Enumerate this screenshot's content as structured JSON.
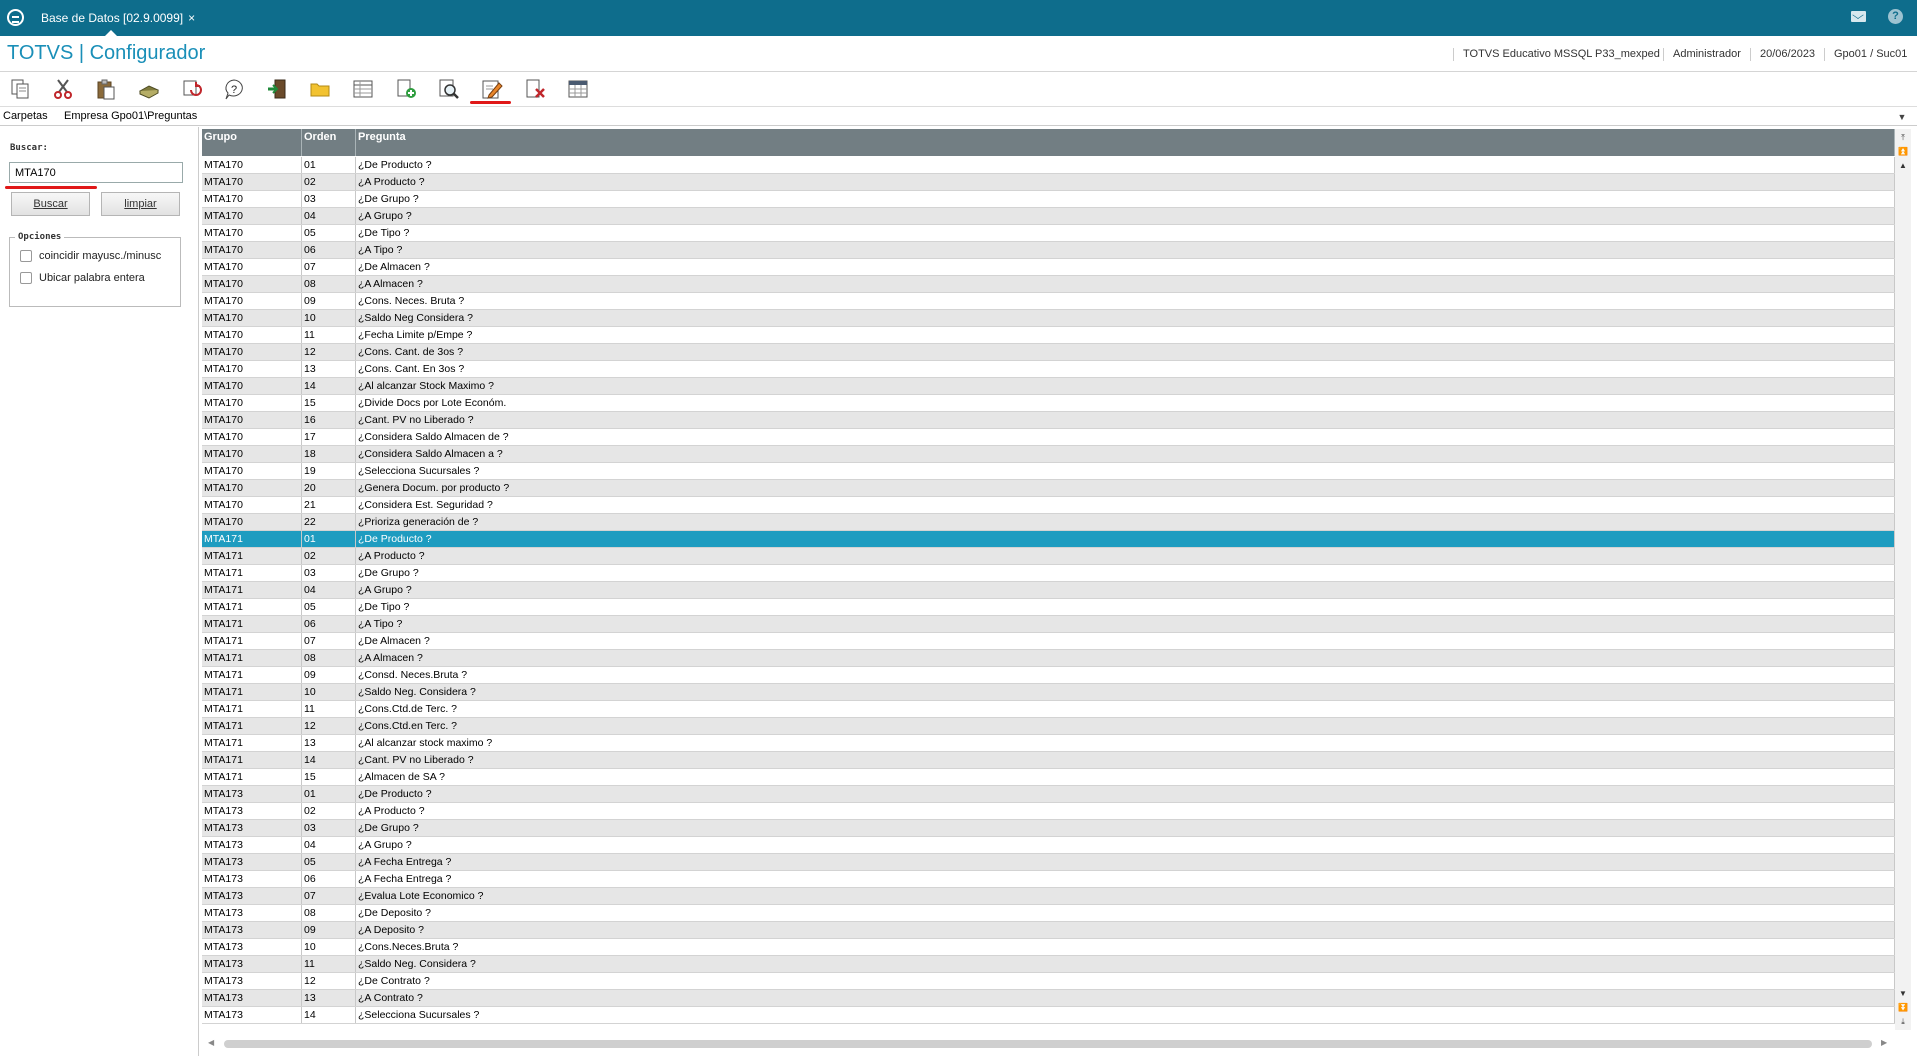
{
  "window_tab": {
    "label": "Base de Datos [02.9.0099]",
    "close": "×"
  },
  "header": {
    "title": "TOTVS | Configurador",
    "environment": "TOTVS Educativo MSSQL P33_mexped",
    "user": "Administrador",
    "date": "20/06/2023",
    "branch": "Gpo01 / Suc01"
  },
  "toolbar": {
    "icons": [
      "copy-icon",
      "cut-icon",
      "paste-icon",
      "book-icon",
      "refresh-icon",
      "help-icon",
      "exit-icon",
      "folder-icon",
      "table-icon",
      "add-document-icon",
      "search-preview-icon",
      "edit-icon",
      "delete-icon",
      "calendar-icon"
    ],
    "highlight_color": "#e01818"
  },
  "path": {
    "label": "Carpetas",
    "value": "Empresa Gpo01\\Preguntas"
  },
  "search": {
    "label": "Buscar:",
    "value": "MTA170",
    "buscar_button": "Buscar",
    "limpiar_button": "limpiar",
    "options_label": "Opciones",
    "opt_case": "coincidir mayusc./minusc",
    "opt_word": "Ubicar palabra entera"
  },
  "grid": {
    "headers": [
      "Grupo",
      "Orden",
      "Pregunta"
    ],
    "selected_index": 22,
    "rows": [
      [
        "MTA170",
        "01",
        "¿De Producto ?"
      ],
      [
        "MTA170",
        "02",
        "¿A Producto ?"
      ],
      [
        "MTA170",
        "03",
        "¿De Grupo ?"
      ],
      [
        "MTA170",
        "04",
        "¿A Grupo ?"
      ],
      [
        "MTA170",
        "05",
        "¿De Tipo ?"
      ],
      [
        "MTA170",
        "06",
        "¿A Tipo ?"
      ],
      [
        "MTA170",
        "07",
        "¿De Almacen ?"
      ],
      [
        "MTA170",
        "08",
        "¿A  Almacen ?"
      ],
      [
        "MTA170",
        "09",
        "¿Cons. Neces. Bruta ?"
      ],
      [
        "MTA170",
        "10",
        "¿Saldo Neg Considera ?"
      ],
      [
        "MTA170",
        "11",
        "¿Fecha Limite p/Empe ?"
      ],
      [
        "MTA170",
        "12",
        "¿Cons. Cant. de 3os ?"
      ],
      [
        "MTA170",
        "13",
        "¿Cons. Cant. En 3os ?"
      ],
      [
        "MTA170",
        "14",
        "¿Al alcanzar Stock Maximo ?"
      ],
      [
        "MTA170",
        "15",
        "¿Divide Docs por Lote Económ."
      ],
      [
        "MTA170",
        "16",
        "¿Cant. PV no Liberado ?"
      ],
      [
        "MTA170",
        "17",
        "¿Considera Saldo Almacen de ?"
      ],
      [
        "MTA170",
        "18",
        "¿Considera Saldo Almacen a ?"
      ],
      [
        "MTA170",
        "19",
        "¿Selecciona Sucursales ?"
      ],
      [
        "MTA170",
        "20",
        "¿Genera Docum. por producto ?"
      ],
      [
        "MTA170",
        "21",
        "¿Considera Est. Seguridad ?"
      ],
      [
        "MTA170",
        "22",
        "¿Prioriza generación de ?"
      ],
      [
        "MTA171",
        "01",
        "¿De Producto ?"
      ],
      [
        "MTA171",
        "02",
        "¿A Producto ?"
      ],
      [
        "MTA171",
        "03",
        "¿De Grupo ?"
      ],
      [
        "MTA171",
        "04",
        "¿A Grupo ?"
      ],
      [
        "MTA171",
        "05",
        "¿De Tipo ?"
      ],
      [
        "MTA171",
        "06",
        "¿A Tipo ?"
      ],
      [
        "MTA171",
        "07",
        "¿De Almacen ?"
      ],
      [
        "MTA171",
        "08",
        "¿A  Almacen ?"
      ],
      [
        "MTA171",
        "09",
        "¿Consd. Neces.Bruta ?"
      ],
      [
        "MTA171",
        "10",
        "¿Saldo Neg. Considera ?"
      ],
      [
        "MTA171",
        "11",
        "¿Cons.Ctd.de Terc. ?"
      ],
      [
        "MTA171",
        "12",
        "¿Cons.Ctd.en Terc. ?"
      ],
      [
        "MTA171",
        "13",
        "¿Al alcanzar stock maximo ?"
      ],
      [
        "MTA171",
        "14",
        "¿Cant. PV no Liberado ?"
      ],
      [
        "MTA171",
        "15",
        "¿Almacen de SA ?"
      ],
      [
        "MTA173",
        "01",
        "¿De Producto ?"
      ],
      [
        "MTA173",
        "02",
        "¿A Producto ?"
      ],
      [
        "MTA173",
        "03",
        "¿De Grupo ?"
      ],
      [
        "MTA173",
        "04",
        "¿A Grupo ?"
      ],
      [
        "MTA173",
        "05",
        "¿A Fecha Entrega ?"
      ],
      [
        "MTA173",
        "06",
        "¿A Fecha Entrega ?"
      ],
      [
        "MTA173",
        "07",
        "¿Evalua Lote Economico ?"
      ],
      [
        "MTA173",
        "08",
        "¿De Deposito ?"
      ],
      [
        "MTA173",
        "09",
        "¿A Deposito ?"
      ],
      [
        "MTA173",
        "10",
        "¿Cons.Neces.Bruta ?"
      ],
      [
        "MTA173",
        "11",
        "¿Saldo Neg. Considera ?"
      ],
      [
        "MTA173",
        "12",
        "¿De Contrato ?"
      ],
      [
        "MTA173",
        "13",
        "¿A Contrato ?"
      ],
      [
        "MTA173",
        "14",
        "¿Selecciona Sucursales ?"
      ]
    ]
  },
  "colors": {
    "titlebar": "#0e6d8c",
    "title_text": "#1a8fb8",
    "selected_row": "#1e9cc0",
    "grid_header": "#727e83"
  }
}
